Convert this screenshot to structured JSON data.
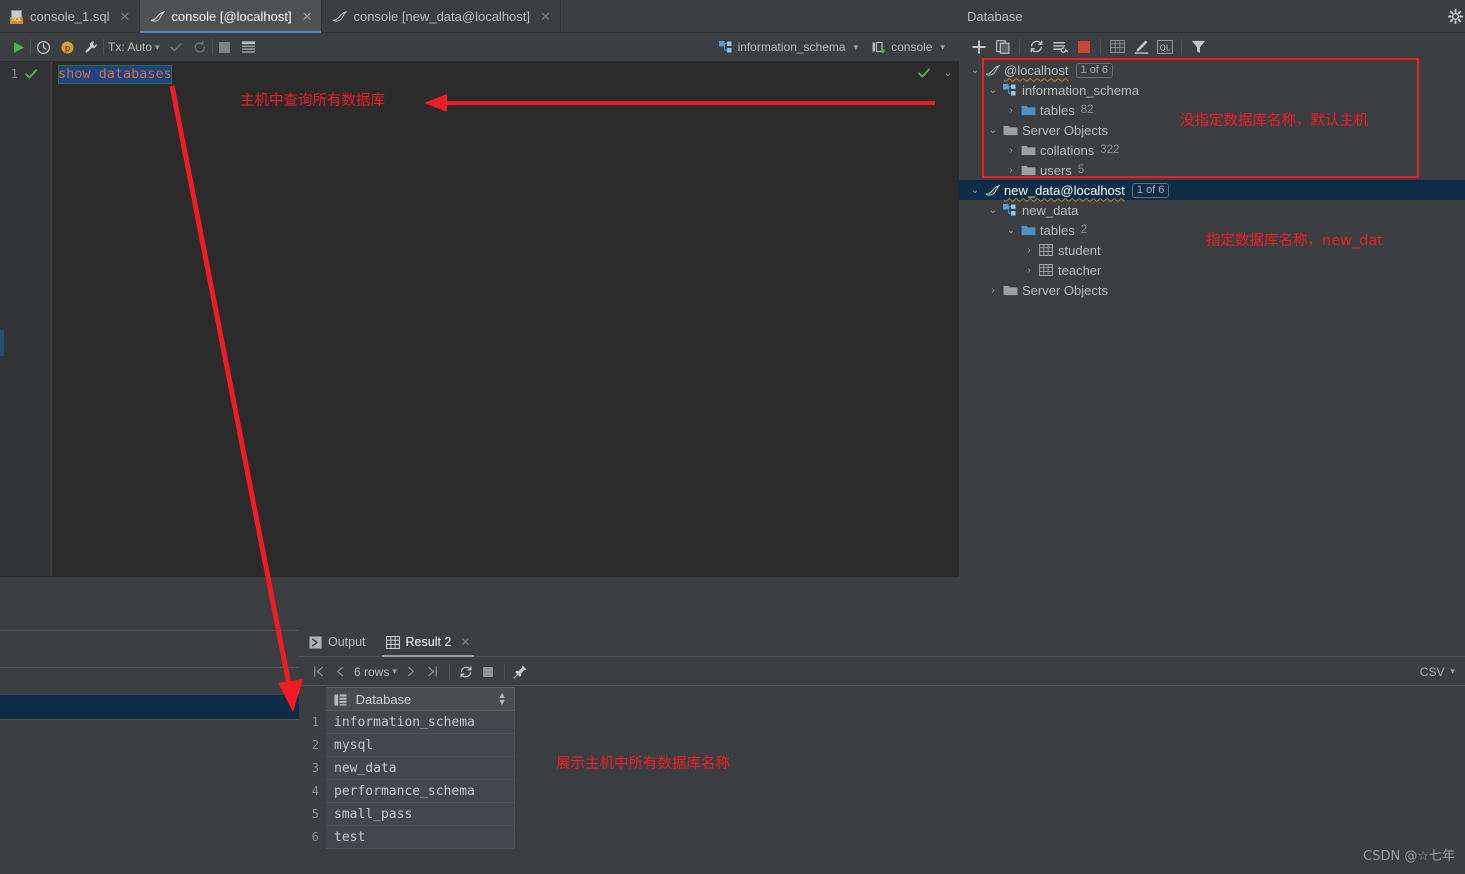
{
  "editor": {
    "tabs": [
      {
        "label": "console_1.sql",
        "icon": "sql-file-icon",
        "active": false,
        "closable": true
      },
      {
        "label": "console [@localhost]",
        "icon": "console-icon",
        "active": true,
        "closable": true
      },
      {
        "label": "console [new_data@localhost]",
        "icon": "console-icon",
        "active": false,
        "closable": true
      }
    ],
    "toolbar": {
      "run_label": "run-icon",
      "history_label": "history-icon",
      "profile_label": "profile-icon",
      "settings_label": "wrench-icon",
      "tx_label": "Tx: Auto",
      "commit_label": "commit-check-icon",
      "rollback_label": "rollback-icon",
      "stop_label": "stop-icon",
      "grid_label": "data-grid-icon",
      "schema_chip": "information_schema",
      "session_chip": "console"
    },
    "gutter": {
      "line_number": "1"
    },
    "code": {
      "line1": "show databases"
    }
  },
  "database_panel": {
    "title": "Database",
    "toolbar_icons": [
      "add-icon",
      "copy-icon",
      "refresh-icon",
      "sync-settings-icon",
      "stop-icon",
      "table-view-icon",
      "edit-icon",
      "ql-console-icon",
      "filter-icon"
    ],
    "tree": [
      {
        "label": "@localhost",
        "icon": "connection-icon",
        "badge": "1 of 6",
        "indent": 0,
        "arrow": "down",
        "selected": false,
        "count": ""
      },
      {
        "label": "information_schema",
        "icon": "schema-icon",
        "badge": "",
        "indent": 1,
        "arrow": "down",
        "selected": false,
        "count": ""
      },
      {
        "label": "tables",
        "icon": "folder-icon",
        "badge": "",
        "indent": 2,
        "arrow": "right",
        "selected": false,
        "count": "82"
      },
      {
        "label": "Server Objects",
        "icon": "folder-gray-icon",
        "badge": "",
        "indent": 1,
        "arrow": "down",
        "selected": false,
        "count": ""
      },
      {
        "label": "collations",
        "icon": "folder-gray-icon",
        "badge": "",
        "indent": 2,
        "arrow": "right",
        "selected": false,
        "count": "322"
      },
      {
        "label": "users",
        "icon": "folder-gray-icon",
        "badge": "",
        "indent": 2,
        "arrow": "right",
        "selected": false,
        "count": "5"
      },
      {
        "label": "new_data@localhost",
        "icon": "connection-icon",
        "badge": "1 of 6",
        "indent": 0,
        "arrow": "down",
        "selected": true,
        "count": ""
      },
      {
        "label": "new_data",
        "icon": "schema-icon",
        "badge": "",
        "indent": 1,
        "arrow": "down",
        "selected": false,
        "count": ""
      },
      {
        "label": "tables",
        "icon": "folder-icon",
        "badge": "",
        "indent": 2,
        "arrow": "down",
        "selected": false,
        "count": "2"
      },
      {
        "label": "student",
        "icon": "table-icon",
        "badge": "",
        "indent": 3,
        "arrow": "right",
        "selected": false,
        "count": ""
      },
      {
        "label": "teacher",
        "icon": "table-icon",
        "badge": "",
        "indent": 3,
        "arrow": "right",
        "selected": false,
        "count": ""
      },
      {
        "label": "Server Objects",
        "icon": "folder-gray-icon",
        "badge": "",
        "indent": 1,
        "arrow": "right",
        "selected": false,
        "count": ""
      }
    ]
  },
  "results": {
    "tabs": [
      {
        "label": "Output",
        "icon": "output-icon",
        "active": false,
        "closable": false
      },
      {
        "label": "Result 2",
        "icon": "grid-icon",
        "active": true,
        "closable": true
      }
    ],
    "toolbar": {
      "first_label": "first-page-icon",
      "prev_label": "prev-page-icon",
      "rows_label": "6 rows",
      "next_label": "next-page-icon",
      "last_label": "last-page-icon",
      "reload_label": "reload-icon",
      "cancel_label": "stop-icon",
      "pin_label": "pin-icon",
      "export_format": "CSV"
    },
    "grid": {
      "columns": [
        "Database"
      ],
      "rows": [
        {
          "num": "1",
          "Database": "information_schema"
        },
        {
          "num": "2",
          "Database": "mysql"
        },
        {
          "num": "3",
          "Database": "new_data"
        },
        {
          "num": "4",
          "Database": "performance_schema"
        },
        {
          "num": "5",
          "Database": "small_pass"
        },
        {
          "num": "6",
          "Database": "test"
        }
      ]
    }
  },
  "annotations": {
    "editor_note": "主机中查询所有数据库",
    "localhost_note": "没指定数据库名称，默认主机",
    "newdata_note": "指定数据库名称，new_dat",
    "result_note": "展示主机中所有数据库名称"
  },
  "watermark": "CSDN @☆七年",
  "colors": {
    "accent_blue": "#4a88c7",
    "annotation_red": "#ee1c24",
    "selection_navy": "#0d2c47",
    "editor_bg": "#2b2b2b",
    "panel_bg": "#3c3f41"
  }
}
